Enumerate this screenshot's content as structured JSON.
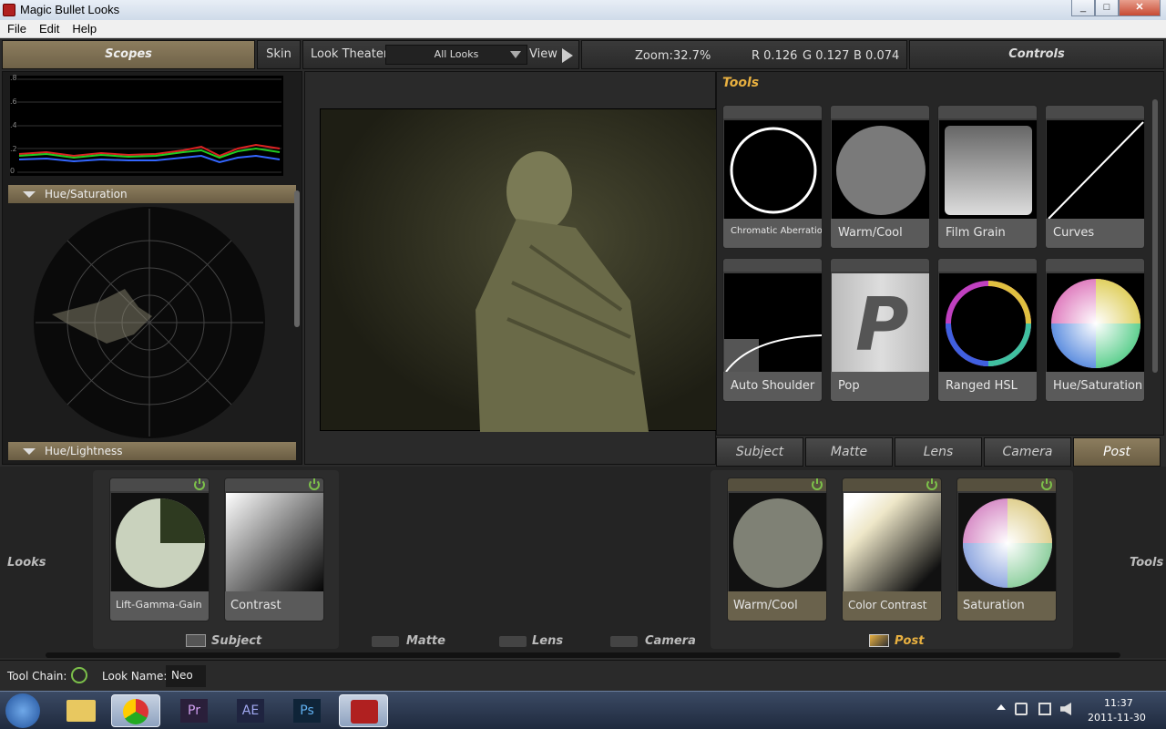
{
  "window": {
    "title": "Magic Bullet Looks",
    "min": "_",
    "max": "□",
    "close": "✕"
  },
  "menu": [
    "File",
    "Edit",
    "Help"
  ],
  "header": {
    "scopes": "Scopes",
    "skin": "Skin",
    "look_theater": "Look Theater",
    "dropdown": "All Looks",
    "view": "View",
    "zoom_label": "Zoom:",
    "zoom_value": "32.7%",
    "r": "R 0.126",
    "g": "G 0.127",
    "b": "B 0.074",
    "controls": "Controls"
  },
  "scopes": {
    "y_ticks": [
      ".8",
      ".6",
      ".4",
      ".2",
      "0"
    ],
    "sections": [
      "Hue/Saturation",
      "Hue/Lightness"
    ]
  },
  "tools": {
    "title": "Tools",
    "items": [
      "Chromatic Aberration",
      "Warm/Cool",
      "Film Grain",
      "Curves",
      "Auto Shoulder",
      "Pop",
      "Ranged HSL",
      "Hue/Saturation"
    ],
    "pop_letter": "P",
    "tabs": [
      "Subject",
      "Matte",
      "Lens",
      "Camera",
      "Post"
    ],
    "active_tab": "Post"
  },
  "chain": {
    "looks_label": "Looks",
    "tools_label": "Tools",
    "subject_items": [
      "Lift-Gamma-Gain",
      "Contrast"
    ],
    "post_items": [
      "Warm/Cool",
      "Color Contrast",
      "Saturation"
    ],
    "categories": [
      "Subject",
      "Matte",
      "Lens",
      "Camera",
      "Post"
    ]
  },
  "status": {
    "tool_chain": "Tool Chain:",
    "look_name_label": "Look Name:",
    "look_name": "Neo"
  },
  "taskbar": {
    "time": "11:37",
    "date": "2011-11-30",
    "apps": [
      "Pr",
      "AE",
      "Ps"
    ]
  },
  "colors": {
    "accent": "#8c7d5e",
    "power": "#7cc04a"
  }
}
